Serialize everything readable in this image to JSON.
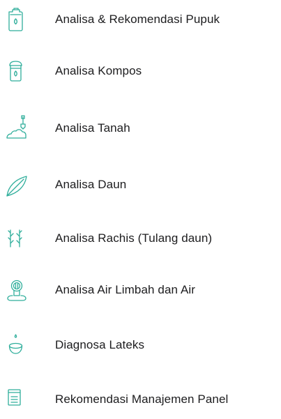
{
  "menu": {
    "items": [
      {
        "label": "Analisa & Rekomendasi Pupuk",
        "icon": "fertilizer-container-icon"
      },
      {
        "label": "Analisa Kompos",
        "icon": "compost-bag-icon"
      },
      {
        "label": "Analisa Tanah",
        "icon": "soil-shovel-icon"
      },
      {
        "label": "Analisa Daun",
        "icon": "leaf-icon"
      },
      {
        "label": "Analisa Rachis (Tulang daun)",
        "icon": "rachis-frond-icon"
      },
      {
        "label": "Analisa Air Limbah dan Air",
        "icon": "waste-water-icon"
      },
      {
        "label": "Diagnosa Lateks",
        "icon": "latex-cup-icon"
      },
      {
        "label": "Rekomendasi Manajemen Panel",
        "icon": "panel-document-icon"
      }
    ]
  },
  "colors": {
    "icon_accent": "#2fae9b",
    "label_text": "#1c1c1e",
    "background": "#ffffff"
  }
}
